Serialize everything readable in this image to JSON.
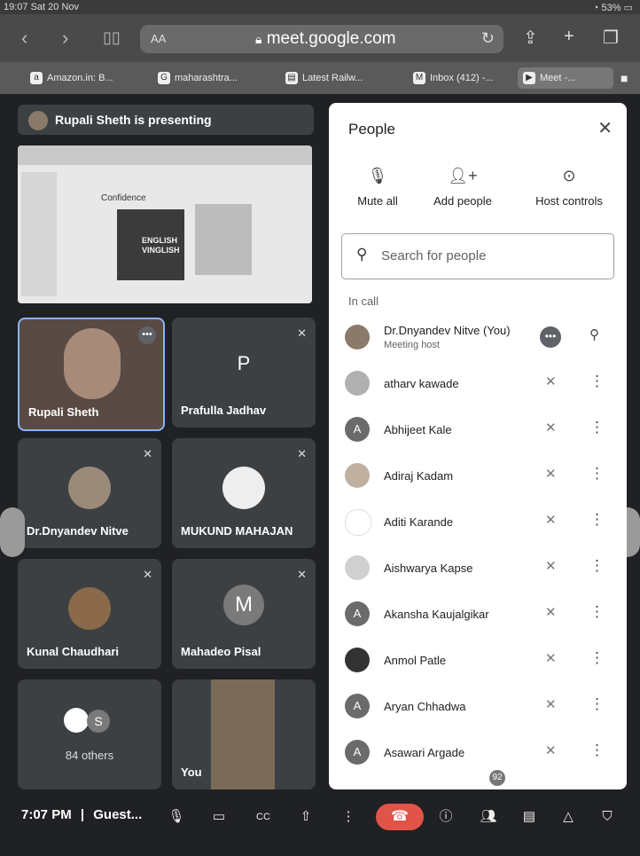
{
  "status": {
    "time_date": "19:07  Sat 20 Nov",
    "battery": "53%"
  },
  "browser": {
    "aa_label": "AA",
    "url": "meet.google.com"
  },
  "tabs": [
    {
      "label": "Amazon.in: B...",
      "icon": "amazon-icon"
    },
    {
      "label": "maharashtra...",
      "icon": "google-icon"
    },
    {
      "label": "Latest Railw...",
      "icon": "page-icon"
    },
    {
      "label": "Inbox (412) -...",
      "icon": "gmail-icon"
    },
    {
      "label": "Meet -...",
      "icon": "meet-icon"
    }
  ],
  "meet": {
    "presenting_text": "Rupali Sheth is presenting",
    "slide": {
      "heading": "Confidence",
      "image_text": "ENGLISH VINGLISH"
    },
    "tiles": [
      {
        "name": "Rupali Sheth",
        "type": "video"
      },
      {
        "name": "Prafulla Jadhav",
        "letter": "P"
      },
      {
        "name": "Dr.Dnyandev Nitve",
        "type": "photo"
      },
      {
        "name": "MUKUND MAHAJAN",
        "type": "photo"
      },
      {
        "name": "Kunal Chaudhari",
        "type": "photo"
      },
      {
        "name": "Mahadeo Pisal",
        "letter": "M"
      },
      {
        "name": "84 others",
        "letter": "S"
      },
      {
        "name": "You",
        "type": "video"
      }
    ]
  },
  "people": {
    "title": "People",
    "actions": [
      {
        "label": "Mute all",
        "icon": "mic-off-icon"
      },
      {
        "label": "Add people",
        "icon": "add-person-icon"
      },
      {
        "label": "Host controls",
        "icon": "toggle-icon"
      }
    ],
    "search_placeholder": "Search for people",
    "section_label": "In call",
    "list": [
      {
        "name": "Dr.Dnyandev Nitve (You)",
        "sub": "Meeting host",
        "avatar": ""
      },
      {
        "name": "atharv kawade",
        "avatar": ""
      },
      {
        "name": "Abhijeet Kale",
        "avatar": "A"
      },
      {
        "name": "Adiraj Kadam",
        "avatar": ""
      },
      {
        "name": "Aditi Karande",
        "avatar": ""
      },
      {
        "name": "Aishwarya Kapse",
        "avatar": ""
      },
      {
        "name": "Akansha Kaujalgikar",
        "avatar": "A"
      },
      {
        "name": "Anmol Patle",
        "avatar": ""
      },
      {
        "name": "Aryan Chhadwa",
        "avatar": "A"
      },
      {
        "name": "Asawari Argade",
        "avatar": "A"
      }
    ]
  },
  "bottom": {
    "time_label": "7:07 PM",
    "separator": "|",
    "meeting_label": "Guest...",
    "people_count": "92"
  }
}
